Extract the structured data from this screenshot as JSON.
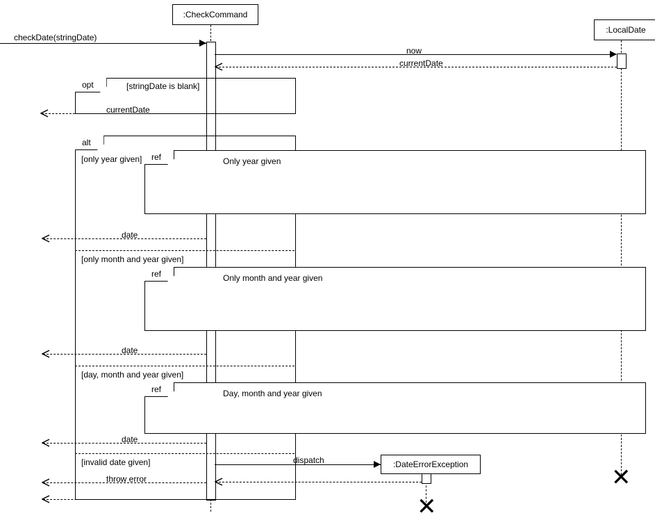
{
  "participants": {
    "checkCommand": ":CheckCommand",
    "localDate": ":LocalDate",
    "dateErrorException": ":DateErrorException"
  },
  "entryCall": "checkDate(stringDate)",
  "messages": {
    "now": "now",
    "currentDate": "currentDate",
    "currentDateReturn": "currentDate",
    "date1": "date",
    "date2": "date",
    "date3": "date",
    "dispatch": "dispatch",
    "throwError": "throw error"
  },
  "fragments": {
    "opt": {
      "tag": "opt",
      "guard": "[stringDate is blank]"
    },
    "alt": {
      "tag": "alt",
      "guards": {
        "g1": "[only year given]",
        "g2": "[only month and year given]",
        "g3": "[day, month and year given]",
        "g4": "[invalid date given]"
      }
    },
    "refs": {
      "ref1": {
        "tag": "ref",
        "title": "Only year given"
      },
      "ref2": {
        "tag": "ref",
        "title": "Only month and year given"
      },
      "ref3": {
        "tag": "ref",
        "title": "Day, month and year given"
      }
    }
  }
}
